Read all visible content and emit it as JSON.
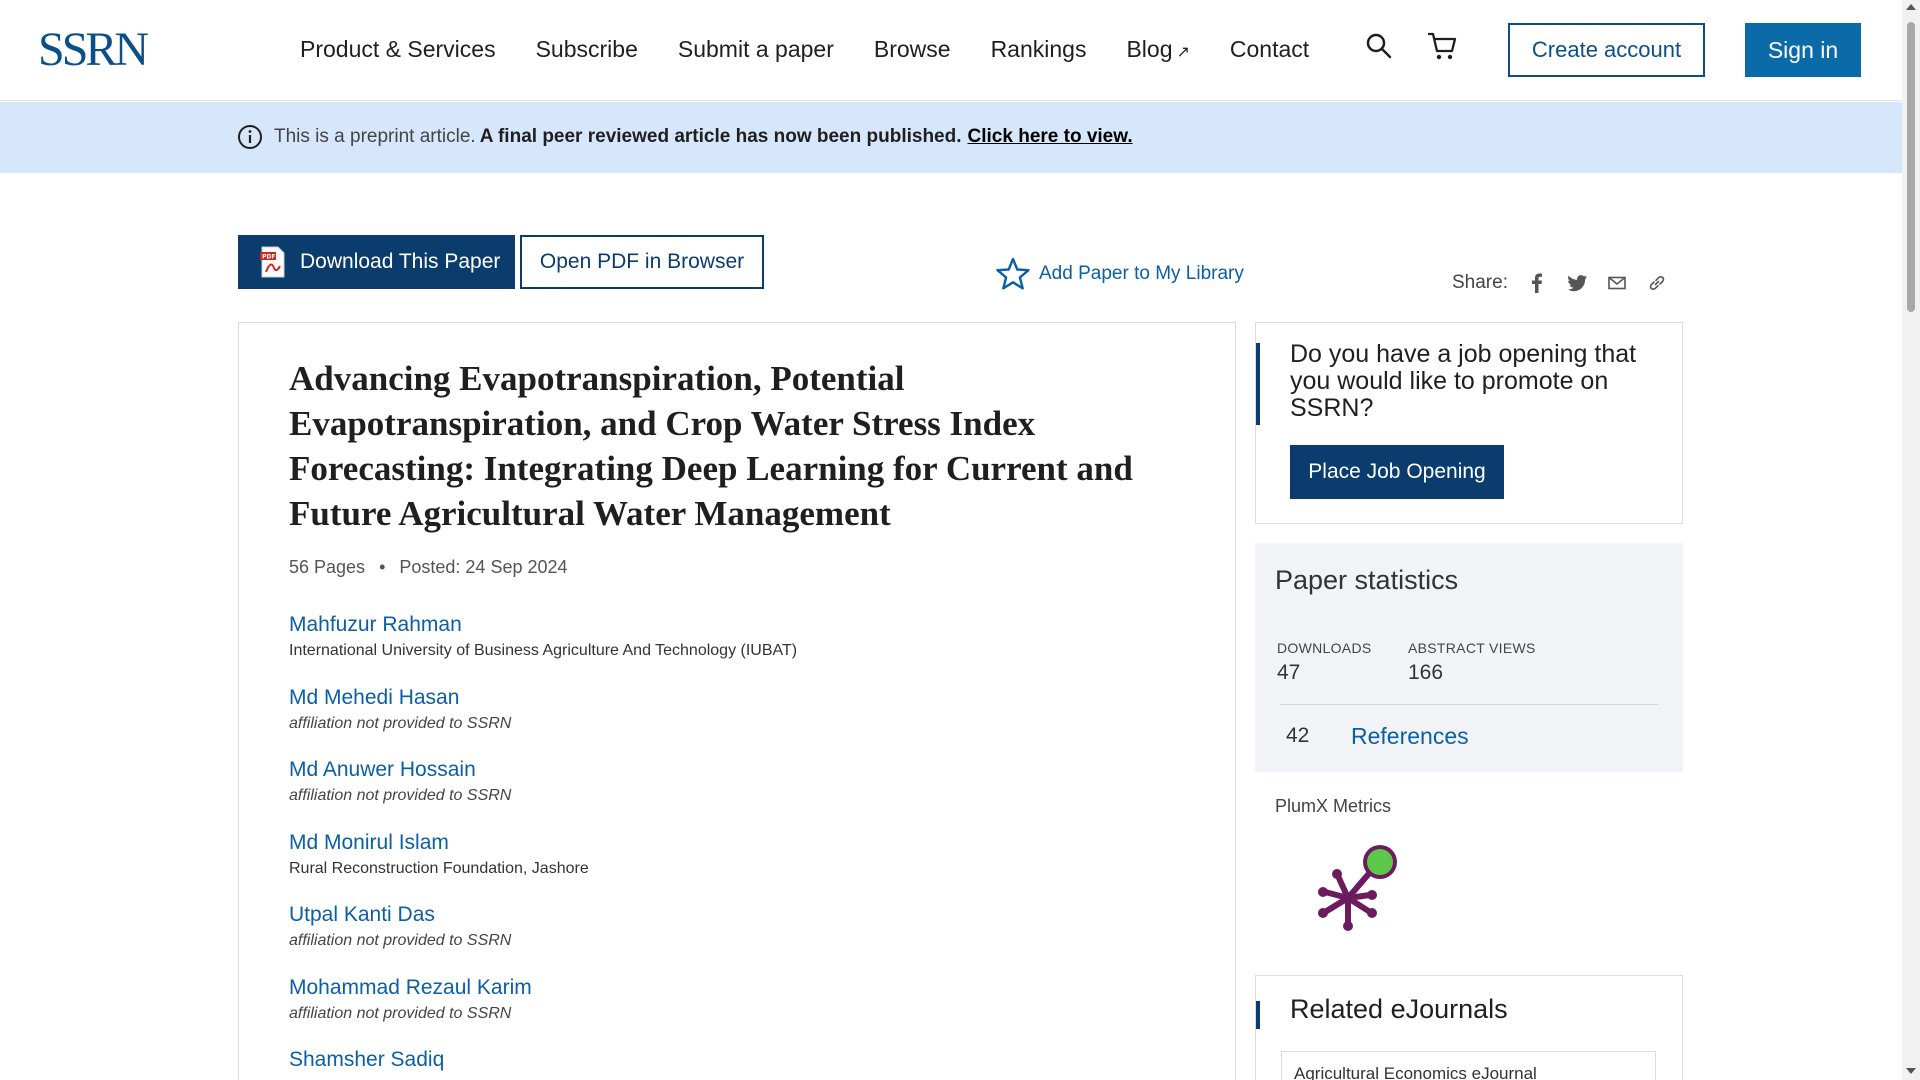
{
  "header": {
    "logo": "SSRN",
    "nav": [
      "Product & Services",
      "Subscribe",
      "Submit a paper",
      "Browse",
      "Rankings",
      "Blog",
      "Contact"
    ],
    "blog_ext_icon": "↗",
    "create_account": "Create account",
    "sign_in": "Sign in"
  },
  "banner": {
    "icon": "info-icon",
    "preprint_text": "This is a preprint article.",
    "published_text": "A final peer reviewed article has now been published.",
    "link_text": "Click here to view."
  },
  "actions": {
    "download": "Download This Paper",
    "open_pdf": "Open PDF in Browser",
    "add_library": "Add Paper to My Library",
    "share_label": "Share:",
    "share_icons": [
      "facebook-icon",
      "twitter-icon",
      "email-icon",
      "link-icon"
    ]
  },
  "paper": {
    "title": "Advancing Evapotranspiration, Potential Evapotranspiration, and Crop Water Stress Index Forecasting: Integrating Deep Learning for Current and Future Agricultural Water Management",
    "pages": "56 Pages",
    "posted": "Posted: 24 Sep 2024",
    "authors": [
      {
        "name": "Mahfuzur Rahman",
        "affiliation": "International University of Business Agriculture And Technology (IUBAT)"
      },
      {
        "name": "Md Mehedi Hasan",
        "affiliation": "affiliation not provided to SSRN"
      },
      {
        "name": "Md Anuwer Hossain",
        "affiliation": "affiliation not provided to SSRN"
      },
      {
        "name": "Md Monirul Islam",
        "affiliation": "Rural Reconstruction Foundation, Jashore"
      },
      {
        "name": "Utpal Kanti Das",
        "affiliation": "affiliation not provided to SSRN"
      },
      {
        "name": "Mohammad Rezaul Karim",
        "affiliation": "affiliation not provided to SSRN"
      },
      {
        "name": "Shamsher Sadiq",
        "affiliation": ""
      }
    ]
  },
  "sidebar": {
    "job_prompt": "Do you have a job opening that you would like to promote on SSRN?",
    "job_button": "Place Job Opening",
    "stats_title": "Paper statistics",
    "downloads_label": "DOWNLOADS",
    "downloads_value": "47",
    "views_label": "ABSTRACT VIEWS",
    "views_value": "166",
    "references_count": "42",
    "references_label": "References",
    "plumx_label": "PlumX Metrics",
    "related_title": "Related eJournals",
    "related_items": [
      "Agricultural Economics eJournal"
    ]
  },
  "colors": {
    "brand": "#0b4f8a",
    "dark_button": "#0a3c6e",
    "signin_button": "#0b6ba8",
    "link": "#0b5fa5",
    "banner_bg": "#d6e6fb",
    "plumx_purple": "#6b1b5e",
    "plumx_green": "#5cc84a"
  }
}
